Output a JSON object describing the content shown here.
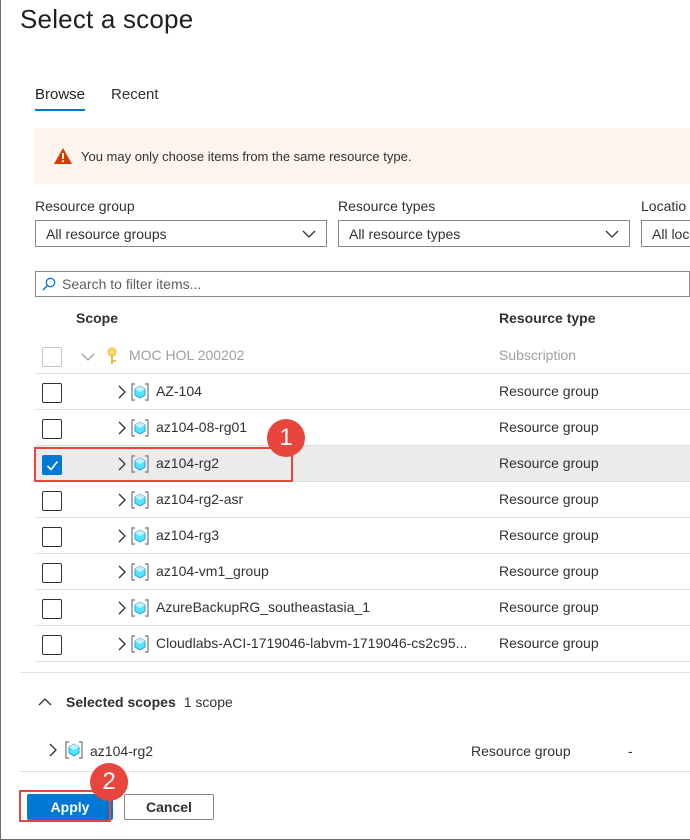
{
  "dialog": {
    "title": "Select a scope"
  },
  "tabs": [
    {
      "label": "Browse",
      "active": true
    },
    {
      "label": "Recent",
      "active": false
    }
  ],
  "warning": {
    "text": "You may only choose items from the same resource type."
  },
  "filters": {
    "resource_group": {
      "label": "Resource group",
      "value": "All resource groups"
    },
    "resource_types": {
      "label": "Resource types",
      "value": "All resource types"
    },
    "location": {
      "label": "Locatio",
      "value": "All loc"
    }
  },
  "search": {
    "placeholder": "Search to filter items..."
  },
  "grid": {
    "columns": {
      "scope": "Scope",
      "resource_type": "Resource type"
    },
    "subscription": {
      "name": "MOC HOL 200202",
      "type": "Subscription"
    },
    "rows": [
      {
        "name": "AZ-104",
        "type": "Resource group",
        "checked": false
      },
      {
        "name": "az104-08-rg01",
        "type": "Resource group",
        "checked": false
      },
      {
        "name": "az104-rg2",
        "type": "Resource group",
        "checked": true
      },
      {
        "name": "az104-rg2-asr",
        "type": "Resource group",
        "checked": false
      },
      {
        "name": "az104-rg3",
        "type": "Resource group",
        "checked": false
      },
      {
        "name": "az104-vm1_group",
        "type": "Resource group",
        "checked": false
      },
      {
        "name": "AzureBackupRG_southeastasia_1",
        "type": "Resource group",
        "checked": false
      },
      {
        "name": "Cloudlabs-ACI-1719046-labvm-1719046-cs2c95...",
        "type": "Resource group",
        "checked": false
      }
    ]
  },
  "selected_scopes": {
    "title": "Selected scopes",
    "count": "1 scope",
    "items": [
      {
        "name": "az104-rg2",
        "type": "Resource group",
        "location": "-"
      }
    ]
  },
  "buttons": {
    "apply": "Apply",
    "cancel": "Cancel"
  },
  "annotations": {
    "step1": "1",
    "step2": "2"
  },
  "colors": {
    "accent": "#0078d4",
    "annotation": "#e8453c",
    "warning_icon": "#d83b01"
  }
}
